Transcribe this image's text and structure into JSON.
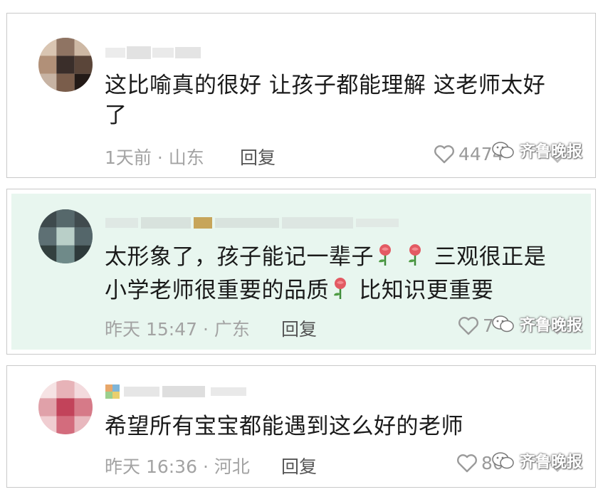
{
  "comments": [
    {
      "text": "这比喻真的很好 让孩子都能理解 这老师太好了",
      "time_location": "1天前 · 山东",
      "reply_label": "回复",
      "likes": "4474"
    },
    {
      "text_part1": "太形象了，孩子能记一辈子",
      "text_part2": "三观很正是小学老师很重要的品质",
      "text_part3": "比知识更重要",
      "time_location": "昨天 15:47 · 广东",
      "reply_label": "回复",
      "likes": "7"
    },
    {
      "text": "希望所有宝宝都能遇到这么好的老师",
      "time_location": "昨天 16:36 · 河北",
      "reply_label": "回复",
      "likes": "80"
    }
  ],
  "watermark": "齐鲁晚报",
  "icons": {
    "like": "heart-outline-icon",
    "rose": "rose-emoji-icon",
    "more": "chevron-down-icon",
    "watermark": "wechat-logo-icon"
  },
  "colors": {
    "highlight_bg": "#e8f6ef",
    "text": "#1a1a1a",
    "meta": "#a3a3a3"
  }
}
